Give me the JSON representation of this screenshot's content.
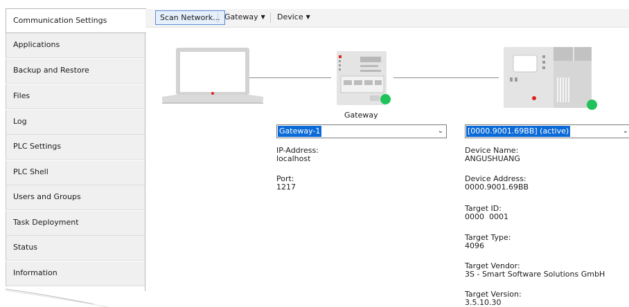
{
  "nav": {
    "items": [
      {
        "label": "Communication Settings",
        "active": true
      },
      {
        "label": "Applications"
      },
      {
        "label": "Backup and Restore"
      },
      {
        "label": "Files"
      },
      {
        "label": "Log"
      },
      {
        "label": "PLC Settings"
      },
      {
        "label": "PLC Shell"
      },
      {
        "label": "Users and Groups"
      },
      {
        "label": "Task Deployment"
      },
      {
        "label": "Status"
      },
      {
        "label": "Information"
      }
    ]
  },
  "toolbar": {
    "scan_label": "Scan Network...",
    "gateway_label": "Gateway",
    "device_label": "Device"
  },
  "topology": {
    "gateway_caption": "Gateway",
    "status_color": "#1fc35a"
  },
  "gateway": {
    "selected": "Gateway-1",
    "ip_label": "IP-Address:",
    "ip_value": "localhost",
    "port_label": "Port:",
    "port_value": "1217"
  },
  "device": {
    "selected": "[0000.9001.69BB] (active)",
    "fields": [
      {
        "label": "Device Name:",
        "value": "ANGUSHUANG"
      },
      {
        "label": "Device Address:",
        "value": "0000.9001.69BB"
      },
      {
        "label": "Target ID:",
        "value": "0000  0001"
      },
      {
        "label": "Target Type:",
        "value": "4096"
      },
      {
        "label": "Target Vendor:",
        "value": "3S - Smart Software Solutions GmbH"
      },
      {
        "label": "Target Version:",
        "value": "3.5.10.30"
      }
    ]
  }
}
